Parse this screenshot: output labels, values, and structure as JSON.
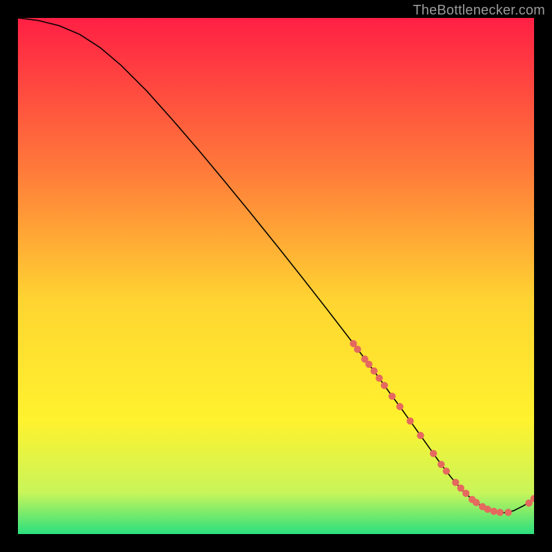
{
  "attribution": "TheBottlenecker.com",
  "colors": {
    "background": "#000000",
    "gradient_top": "#ff1f44",
    "gradient_upper_mid": "#ff7c3a",
    "gradient_mid": "#ffd531",
    "gradient_lower_mid": "#fff22e",
    "gradient_lower": "#c8f55a",
    "gradient_bottom": "#2be07e",
    "curve": "#000000",
    "marker": "#e5695e"
  },
  "chart_data": {
    "type": "line",
    "title": "",
    "xlabel": "",
    "ylabel": "",
    "xlim": [
      0,
      100
    ],
    "ylim": [
      0,
      100
    ],
    "curve": {
      "x": [
        0,
        4,
        8,
        12,
        16,
        20,
        25,
        30,
        35,
        40,
        45,
        50,
        55,
        60,
        65,
        68,
        70,
        72,
        74,
        76,
        78,
        80,
        82,
        84,
        86,
        88,
        90,
        92,
        94,
        96,
        98,
        100
      ],
      "y": [
        100,
        99.5,
        98.5,
        96.8,
        94.2,
        90.8,
        85.8,
        80.2,
        74.4,
        68.4,
        62.3,
        56.1,
        49.8,
        43.4,
        36.9,
        32.9,
        30.2,
        27.4,
        24.7,
        21.9,
        19.1,
        16.3,
        13.5,
        10.9,
        8.6,
        6.7,
        5.3,
        4.4,
        4.1,
        4.5,
        5.5,
        6.9
      ]
    },
    "markers": [
      {
        "x": 65.0,
        "y": 36.9
      },
      {
        "x": 65.8,
        "y": 35.8
      },
      {
        "x": 67.2,
        "y": 33.9
      },
      {
        "x": 68.0,
        "y": 32.9
      },
      {
        "x": 69.0,
        "y": 31.6
      },
      {
        "x": 70.0,
        "y": 30.2
      },
      {
        "x": 71.0,
        "y": 28.8
      },
      {
        "x": 72.5,
        "y": 26.7
      },
      {
        "x": 74.0,
        "y": 24.7
      },
      {
        "x": 76.0,
        "y": 21.9
      },
      {
        "x": 78.0,
        "y": 19.1
      },
      {
        "x": 80.5,
        "y": 15.6
      },
      {
        "x": 82.0,
        "y": 13.5
      },
      {
        "x": 83.0,
        "y": 12.2
      },
      {
        "x": 84.8,
        "y": 10.0
      },
      {
        "x": 85.8,
        "y": 8.9
      },
      {
        "x": 86.8,
        "y": 7.9
      },
      {
        "x": 88.0,
        "y": 6.7
      },
      {
        "x": 88.8,
        "y": 6.1
      },
      {
        "x": 90.0,
        "y": 5.3
      },
      {
        "x": 91.0,
        "y": 4.8
      },
      {
        "x": 92.2,
        "y": 4.4
      },
      {
        "x": 93.4,
        "y": 4.2
      },
      {
        "x": 95.0,
        "y": 4.2
      },
      {
        "x": 99.0,
        "y": 6.0
      },
      {
        "x": 100.0,
        "y": 6.9
      }
    ]
  }
}
